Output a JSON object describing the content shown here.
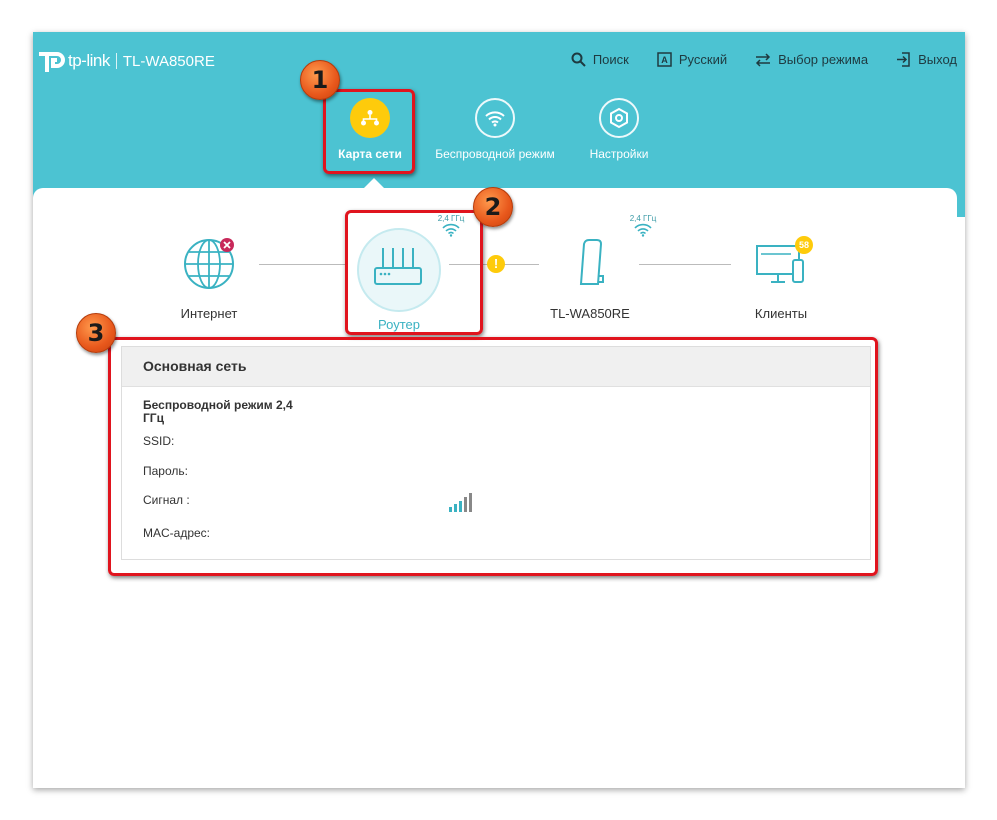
{
  "header": {
    "brand": "tp-link",
    "model": "TL-WA850RE",
    "nav": [
      {
        "label": "Поиск",
        "icon": "search-icon"
      },
      {
        "label": "Русский",
        "icon": "language-icon"
      },
      {
        "label": "Выбор режима",
        "icon": "mode-switch-icon"
      },
      {
        "label": "Выход",
        "icon": "logout-icon"
      }
    ],
    "tabs": [
      {
        "label": "Карта сети",
        "icon": "network-map-icon",
        "active": true
      },
      {
        "label": "Беспроводной режим",
        "icon": "wireless-icon",
        "active": false
      },
      {
        "label": "Настройки",
        "icon": "settings-icon",
        "active": false
      }
    ]
  },
  "network_map": {
    "nodes": [
      {
        "label": "Интернет",
        "icon": "globe-icon",
        "status": "disconnected"
      },
      {
        "label": "Роутер",
        "icon": "router-icon",
        "band": "2,4 ГГц"
      },
      {
        "label": "TL-WA850RE",
        "icon": "extender-icon",
        "band": "2,4 ГГц"
      },
      {
        "label": "Клиенты",
        "icon": "clients-icon",
        "count": "58"
      }
    ]
  },
  "panel": {
    "title": "Основная сеть",
    "section_title": "Беспроводной режим 2,4 ГГц",
    "fields": [
      {
        "label": "SSID:",
        "value": ""
      },
      {
        "label": "Пароль:",
        "value": ""
      },
      {
        "label": "Сигнал :",
        "value": ""
      },
      {
        "label": "MAC-адрес:",
        "value": ""
      }
    ]
  },
  "annotations": [
    "1",
    "2",
    "3"
  ],
  "colors": {
    "header": "#4cc3d2",
    "accent_yellow": "#fecb0b",
    "highlight_red": "#e0141e",
    "badge_orange": "#e8581c",
    "error_pink": "#c8285a"
  }
}
